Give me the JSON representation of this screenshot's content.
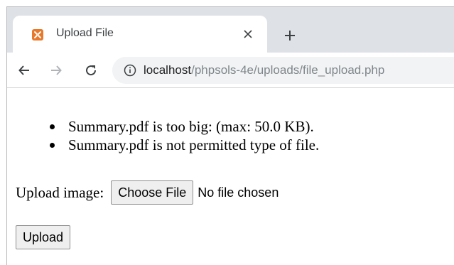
{
  "browser": {
    "tab": {
      "title": "Upload File",
      "favicon": "xampp-icon",
      "close_icon": "close-icon"
    },
    "new_tab_icon": "plus-icon",
    "toolbar": {
      "back_icon": "arrow-left-icon",
      "forward_icon": "arrow-right-icon",
      "reload_icon": "reload-icon",
      "info_icon": "info-icon"
    },
    "url": {
      "host": "localhost",
      "path": "/phpsols-4e/uploads/file_upload.php"
    },
    "colors": {
      "tabstrip": "#dee1e6",
      "omnibox": "#f1f3f4",
      "favicon": "#e8792b"
    }
  },
  "page": {
    "errors": [
      "Summary.pdf is too big: (max: 50.0 KB).",
      "Summary.pdf is not permitted type of file."
    ],
    "upload_label": "Upload image:",
    "choose_button": "Choose File",
    "file_status": "No file chosen",
    "submit_button": "Upload"
  }
}
